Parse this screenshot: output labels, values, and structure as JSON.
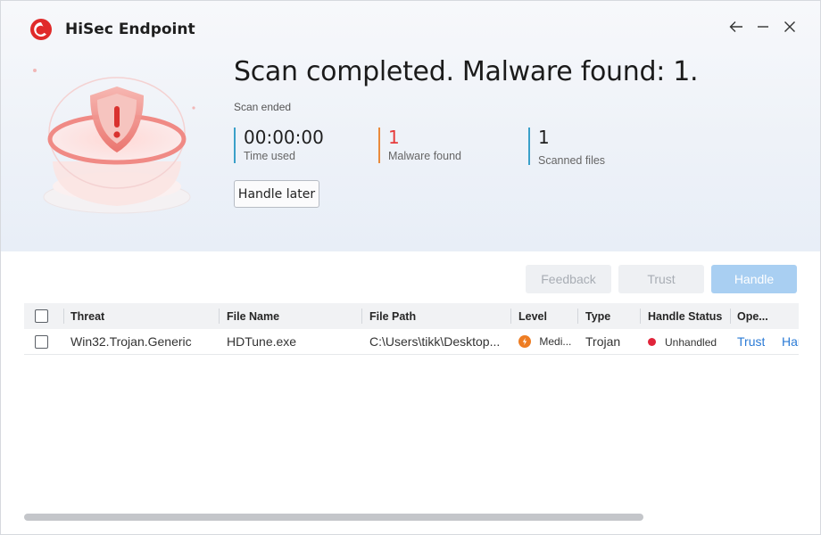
{
  "app": {
    "title": "HiSec Endpoint"
  },
  "window_controls": {
    "back": "back-arrow-icon",
    "minimize": "minimize-icon",
    "close": "close-icon"
  },
  "scan": {
    "headline": "Scan completed. Malware found: 1.",
    "status": "Scan ended",
    "stats": {
      "time_used": {
        "value": "00:00:00",
        "label": "Time used"
      },
      "malware_found": {
        "value": "1",
        "label": "Malware found"
      },
      "scanned_files": {
        "value": "1",
        "label": "Scanned files"
      }
    },
    "handle_later_label": "Handle later"
  },
  "actions": {
    "feedback": "Feedback",
    "trust": "Trust",
    "handle": "Handle"
  },
  "table": {
    "columns": {
      "threat": "Threat",
      "file_name": "File Name",
      "file_path": "File Path",
      "level": "Level",
      "type": "Type",
      "handle_status": "Handle Status",
      "operation": "Ope..."
    },
    "rows": [
      {
        "threat": "Win32.Trojan.Generic",
        "file_name": "HDTune.exe",
        "file_path": "C:\\Users\\tikk\\Desktop...",
        "level": "Medi...",
        "type": "Trojan",
        "handle_status": "Unhandled",
        "op_trust": "Trust",
        "op_handle": "Har"
      }
    ]
  },
  "colors": {
    "accent_blue": "#2b7bd6",
    "malware_red": "#e63b3b",
    "level_orange": "#ee7d23",
    "status_red": "#e0243a",
    "handle_button_disabled": "#a9cff2"
  }
}
